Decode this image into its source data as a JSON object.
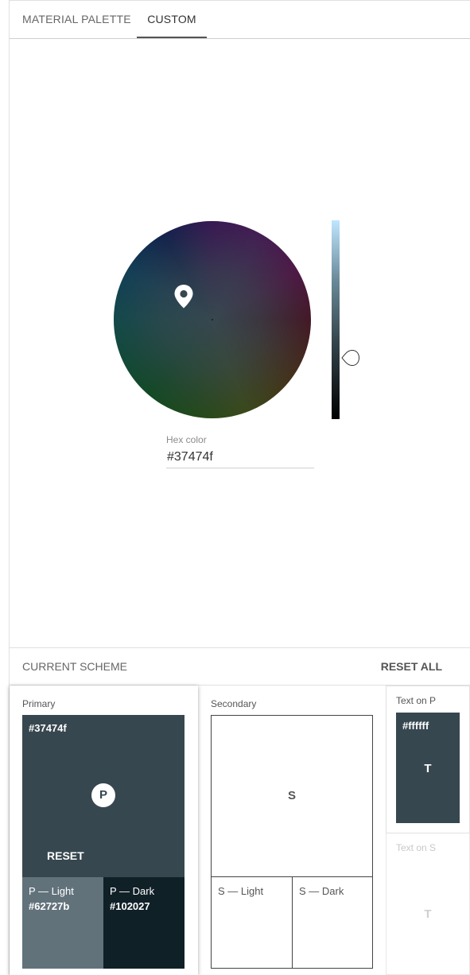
{
  "tabs": [
    {
      "label": "MATERIAL PALETTE"
    },
    {
      "label": "CUSTOM"
    }
  ],
  "active_tab": "CUSTOM",
  "picker": {
    "hex_label": "Hex color",
    "hex_value": "#37474f"
  },
  "scheme": {
    "title": "CURRENT SCHEME",
    "reset_all": "RESET ALL",
    "primary": {
      "label": "Primary",
      "hex": "#37474f",
      "letter": "P",
      "reset": "RESET",
      "light_label": "P — Light",
      "light_hex": "#62727b",
      "dark_label": "P — Dark",
      "dark_hex": "#102027"
    },
    "secondary": {
      "label": "Secondary",
      "letter": "S",
      "light_label": "S — Light",
      "dark_label": "S — Dark"
    },
    "text_on_p": {
      "label": "Text on P",
      "hex": "#ffffff",
      "letter": "T"
    },
    "text_on_s": {
      "label": "Text on S",
      "letter": "T"
    }
  },
  "colors": {
    "primary": "#37474f",
    "primary_light": "#62727b",
    "primary_dark": "#102027",
    "text_on_p": "#ffffff"
  }
}
